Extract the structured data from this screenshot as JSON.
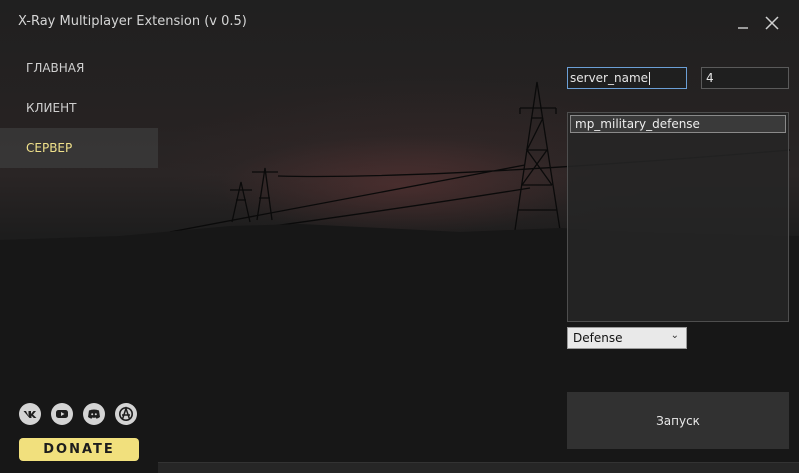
{
  "window": {
    "title": "X-Ray Multiplayer Extension (v 0.5)",
    "minimize_icon": "minimize-icon",
    "close_icon": "close-icon"
  },
  "nav": {
    "items": [
      {
        "label": "ГЛАВНАЯ",
        "active": false
      },
      {
        "label": "КЛИЕНТ",
        "active": false
      },
      {
        "label": "СЕРВЕР",
        "active": true
      }
    ]
  },
  "server": {
    "name_value": "server_name",
    "slots_value": "4",
    "maps": [
      "mp_military_defense"
    ],
    "mode_selected": "Defense",
    "launch_label": "Запуск"
  },
  "social": {
    "icons": [
      "vk-icon",
      "youtube-icon",
      "discord-icon",
      "anarchy-icon"
    ]
  },
  "donate_label": "DONATE",
  "colors": {
    "accent_yellow": "#f1e07d",
    "active_nav_text": "#efe08a",
    "focus_border": "#6b9fd6"
  }
}
